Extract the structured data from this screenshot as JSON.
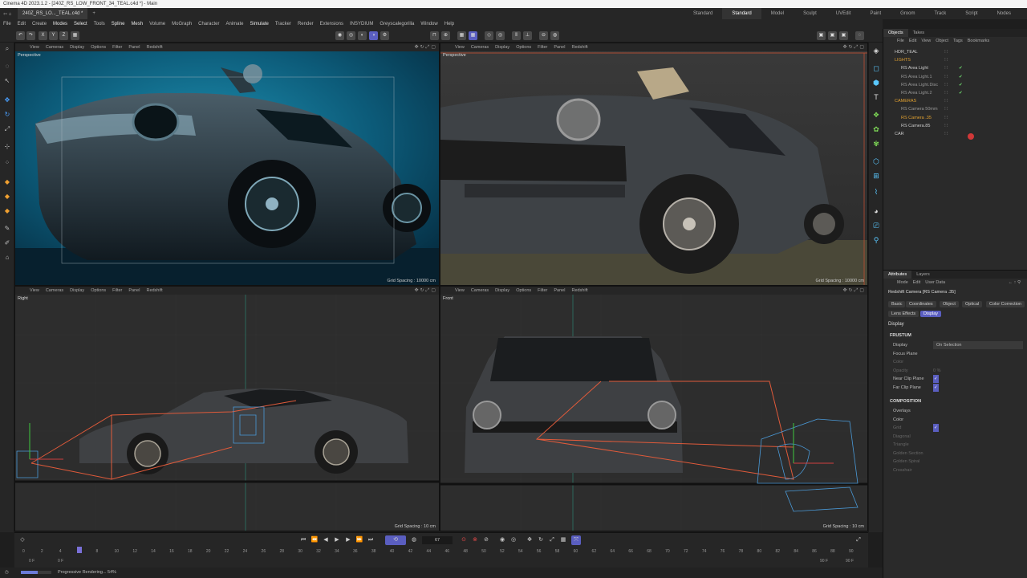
{
  "window": {
    "title": "Cinema 4D 2023.1.2 - [240Z_RS_LOW_FRONT_34_TEAL.c4d *] - Main"
  },
  "document_tab": "240Z_RS_LO..._TEAL.c4d *",
  "layouts": [
    "Standard RS",
    "Standard",
    "Model",
    "Sculpt",
    "UVEdit",
    "Paint",
    "Groom",
    "Track",
    "Script",
    "Nodes",
    "New Layouts"
  ],
  "active_layout": "Standard",
  "menu": [
    "File",
    "Edit",
    "Create",
    "Modes",
    "Select",
    "Tools",
    "Spline",
    "Mesh",
    "Volume",
    "MoGraph",
    "Character",
    "Animate",
    "Simulate",
    "Tracker",
    "Render",
    "Extensions",
    "INSYDIUM",
    "Greyscalegorilla",
    "Window",
    "Help"
  ],
  "viewports": [
    {
      "label": "Perspective",
      "menu": [
        "View",
        "Cameras",
        "Display",
        "Options",
        "Filter",
        "Panel",
        "Redshift"
      ],
      "grid": "Grid Spacing : 10000 cm"
    },
    {
      "label": "Perspective",
      "menu": [
        "View",
        "Cameras",
        "Display",
        "Options",
        "Filter",
        "Panel",
        "Redshift"
      ],
      "grid": "Grid Spacing : 10000 cm"
    },
    {
      "label": "Right",
      "menu": [
        "View",
        "Cameras",
        "Display",
        "Options",
        "Filter",
        "Panel",
        "Redshift"
      ],
      "grid": "Grid Spacing : 10 cm"
    },
    {
      "label": "Front",
      "menu": [
        "View",
        "Cameras",
        "Display",
        "Options",
        "Filter",
        "Panel",
        "Redshift"
      ],
      "grid": "Grid Spacing : 10 cm"
    }
  ],
  "objects_panel": {
    "tabs": [
      "Objects",
      "Takes"
    ],
    "menu": [
      "File",
      "Edit",
      "View",
      "Object",
      "Tags",
      "Bookmarks"
    ],
    "items": [
      {
        "name": "HDR_TEAL",
        "indent": 0,
        "color": "#ccc"
      },
      {
        "name": "LIGHTS",
        "indent": 0,
        "color": "#e0a030"
      },
      {
        "name": "RS Area Light",
        "indent": 1,
        "color": "#ccc",
        "check": true
      },
      {
        "name": "RS Area Light.1",
        "indent": 1,
        "color": "#999",
        "check": true
      },
      {
        "name": "RS Area Light.Disc",
        "indent": 1,
        "color": "#999",
        "check": true
      },
      {
        "name": "RS Area Light.2",
        "indent": 1,
        "color": "#999",
        "check": true
      },
      {
        "name": "CAMERAS",
        "indent": 0,
        "color": "#e0a030"
      },
      {
        "name": "RS Camera 50mm",
        "indent": 1,
        "color": "#999"
      },
      {
        "name": "RS Camera .35",
        "indent": 1,
        "color": "#e0a030"
      },
      {
        "name": "RS Camera.85",
        "indent": 1,
        "color": "#ccc"
      },
      {
        "name": "CAR",
        "indent": 0,
        "color": "#ccc"
      }
    ]
  },
  "attributes": {
    "tabs": [
      "Attributes",
      "Layers"
    ],
    "menu": [
      "Mode",
      "Edit",
      "User Data"
    ],
    "object": "Redshift Camera [RS Camera .35]",
    "tab_buttons": [
      "Basic",
      "Coordinates",
      "Object",
      "Optical",
      "Color Correction",
      "Lens Effects",
      "Display"
    ],
    "active_tab": "Display",
    "section": "Display",
    "frustum_header": "FRUSTUM",
    "frustum": [
      {
        "label": "Display",
        "value": "On Selection"
      },
      {
        "label": "Focus Plane",
        "value": ""
      },
      {
        "label": "Color",
        "value": ""
      },
      {
        "label": "Opacity",
        "value": "0 %"
      },
      {
        "label": "Near Clip Plane",
        "value": "✓"
      },
      {
        "label": "Far Clip Plane",
        "value": "✓"
      }
    ],
    "composition_header": "COMPOSITION",
    "composition": [
      {
        "label": "Overlays",
        "value": ""
      },
      {
        "label": "Color",
        "value": ""
      },
      {
        "label": "Grid",
        "value": "✓"
      },
      {
        "label": "Diagonal",
        "value": ""
      },
      {
        "label": "Triangle",
        "value": ""
      },
      {
        "label": "Golden Section",
        "value": ""
      },
      {
        "label": "Golden Spiral",
        "value": ""
      },
      {
        "label": "Crosshair",
        "value": ""
      }
    ]
  },
  "timeline": {
    "frame": "67",
    "start": "0 F",
    "current_start": "0 F",
    "end": "90 F",
    "end2": "90 F",
    "ticks": [
      "0",
      "2",
      "4",
      "6",
      "8",
      "10",
      "12",
      "14",
      "16",
      "18",
      "20",
      "22",
      "24",
      "26",
      "28",
      "30",
      "32",
      "34",
      "36",
      "38",
      "40",
      "42",
      "44",
      "46",
      "48",
      "50",
      "52",
      "54",
      "56",
      "58",
      "60",
      "62",
      "64",
      "66",
      "68",
      "70",
      "72",
      "74",
      "76",
      "78",
      "80",
      "82",
      "84",
      "86",
      "88",
      "90"
    ]
  },
  "status": {
    "text": "Progressive Rendering... 54%",
    "progress": 0.54
  }
}
